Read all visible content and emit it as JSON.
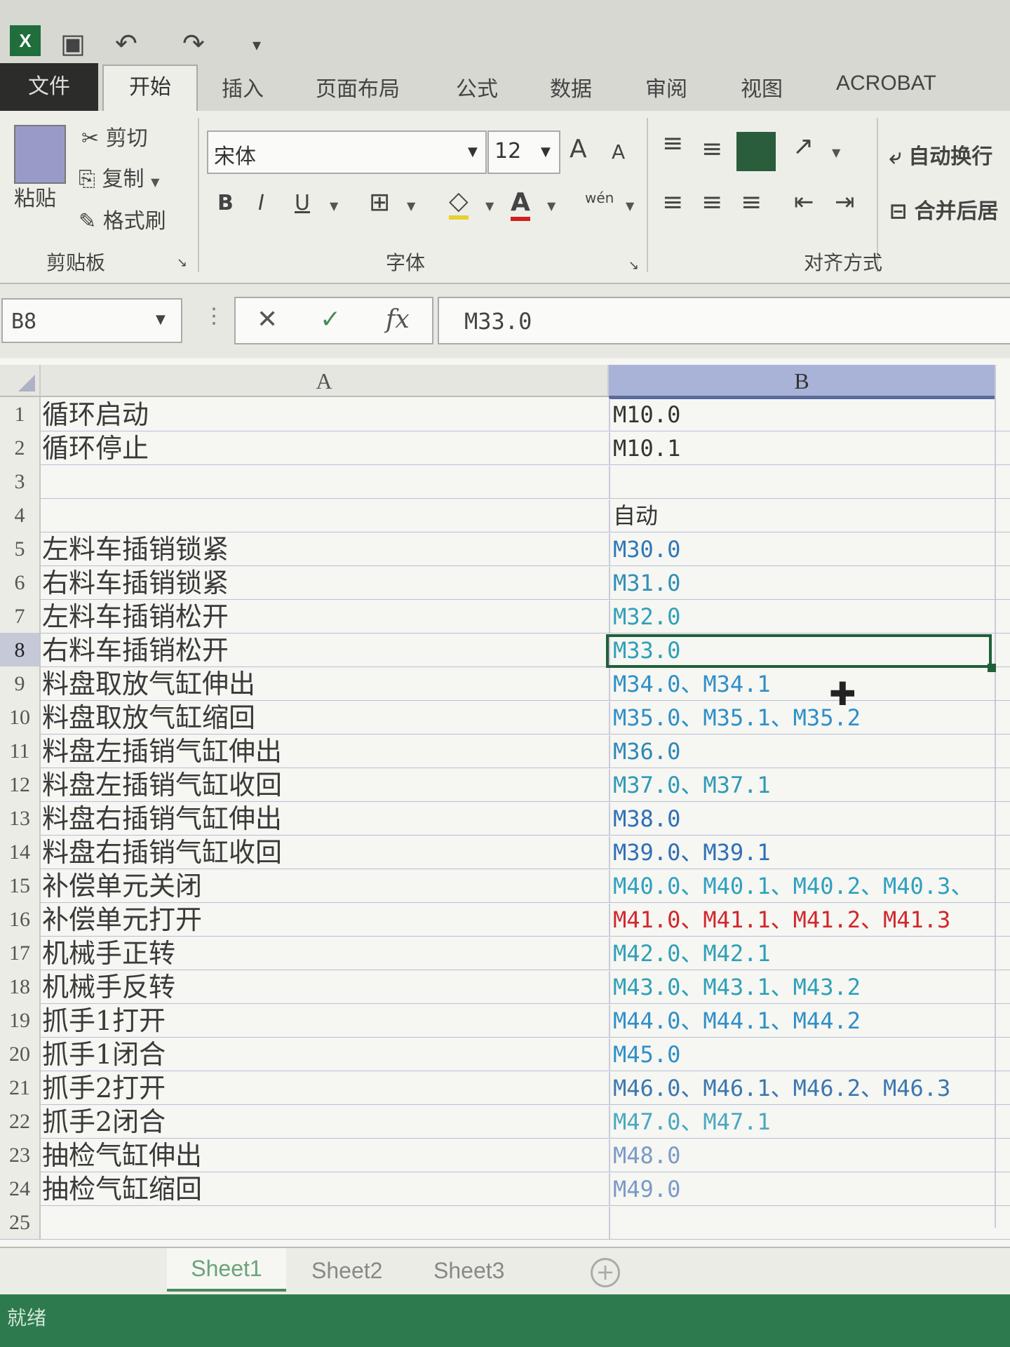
{
  "quick_access": {
    "logo": "X",
    "save_icon": "save-icon",
    "undo_icon": "undo-icon",
    "redo_icon": "redo-icon"
  },
  "tabs": [
    "文件",
    "开始",
    "插入",
    "页面布局",
    "公式",
    "数据",
    "审阅",
    "视图",
    "ACROBAT"
  ],
  "ribbon": {
    "clipboard": {
      "paste": "粘贴",
      "cut": "剪切",
      "copy": "复制",
      "format_painter": "格式刷",
      "label": "剪贴板"
    },
    "font": {
      "name": "宋体",
      "size": "12",
      "label": "字体",
      "bold": "B",
      "italic": "I",
      "underline": "U",
      "font_color": "A",
      "grow": "A",
      "shrink": "A",
      "phonetic": "wén"
    },
    "alignment": {
      "wrap": "自动换行",
      "merge": "合并后居",
      "label": "对齐方式"
    }
  },
  "formula_bar": {
    "name_box": "B8",
    "cancel": "✕",
    "confirm": "✓",
    "fx": "fx",
    "content": "M33.0"
  },
  "columns": [
    "A",
    "B"
  ],
  "rows": [
    {
      "n": "1",
      "a": "循环启动",
      "b": "M10.0",
      "color": "#333333"
    },
    {
      "n": "2",
      "a": "循环停止",
      "b": "M10.1",
      "color": "#333333"
    },
    {
      "n": "3",
      "a": "",
      "b": "",
      "color": "#333333"
    },
    {
      "n": "4",
      "a": "",
      "b": "自动",
      "color": "#333333"
    },
    {
      "n": "5",
      "a": "左料车插销锁紧",
      "b": "M30.0",
      "color": "#2e78b8"
    },
    {
      "n": "6",
      "a": "右料车插销锁紧",
      "b": "M31.0",
      "color": "#2e8fb8"
    },
    {
      "n": "7",
      "a": "左料车插销松开",
      "b": "M32.0",
      "color": "#2ea0b8"
    },
    {
      "n": "8",
      "a": "右料车插销松开",
      "b": "M33.0",
      "color": "#2ea0b8"
    },
    {
      "n": "9",
      "a": "料盘取放气缸伸出",
      "b": "M34.0、M34.1",
      "color": "#2e8fc8"
    },
    {
      "n": "10",
      "a": "料盘取放气缸缩回",
      "b": "M35.0、M35.1、M35.2",
      "color": "#2e8fc8"
    },
    {
      "n": "11",
      "a": "料盘左插销气缸伸出",
      "b": "M36.0",
      "color": "#2e88b8"
    },
    {
      "n": "12",
      "a": "料盘左插销气缸收回",
      "b": "M37.0、M37.1",
      "color": "#2e9ab8"
    },
    {
      "n": "13",
      "a": "料盘右插销气缸伸出",
      "b": "M38.0",
      "color": "#2e6fb8"
    },
    {
      "n": "14",
      "a": "料盘右插销气缸收回",
      "b": "M39.0、M39.1",
      "color": "#2e6fb8"
    },
    {
      "n": "15",
      "a": "补偿单元关闭",
      "b": "M40.0、M40.1、M40.2、M40.3、",
      "color": "#2ea0c0"
    },
    {
      "n": "16",
      "a": "补偿单元打开",
      "b": "M41.0、M41.1、M41.2、M41.3",
      "color": "#d0282e"
    },
    {
      "n": "17",
      "a": "机械手正转",
      "b": "M42.0、M42.1",
      "color": "#2ea0b8"
    },
    {
      "n": "18",
      "a": "机械手反转",
      "b": "M43.0、M43.1、M43.2",
      "color": "#2ea0b8"
    },
    {
      "n": "19",
      "a": "抓手1打开",
      "b": "M44.0、M44.1、M44.2",
      "color": "#2e8fc8"
    },
    {
      "n": "20",
      "a": "抓手1闭合",
      "b": "M45.0",
      "color": "#2e8fc8"
    },
    {
      "n": "21",
      "a": "抓手2打开",
      "b": "M46.0、M46.1、M46.2、M46.3",
      "color": "#3a78b0"
    },
    {
      "n": "22",
      "a": "抓手2闭合",
      "b": "M47.0、M47.1",
      "color": "#4aa8c0"
    },
    {
      "n": "23",
      "a": "抽检气缸伸出",
      "b": "M48.0",
      "color": "#7a9ac8"
    },
    {
      "n": "24",
      "a": "抽检气缸缩回",
      "b": "M49.0",
      "color": "#7a9ac8"
    },
    {
      "n": "25",
      "a": "",
      "b": "",
      "color": "#333333"
    }
  ],
  "selected_row": "8",
  "sheets": [
    "Sheet1",
    "Sheet2",
    "Sheet3"
  ],
  "add_sheet": "+",
  "status": "就绪"
}
